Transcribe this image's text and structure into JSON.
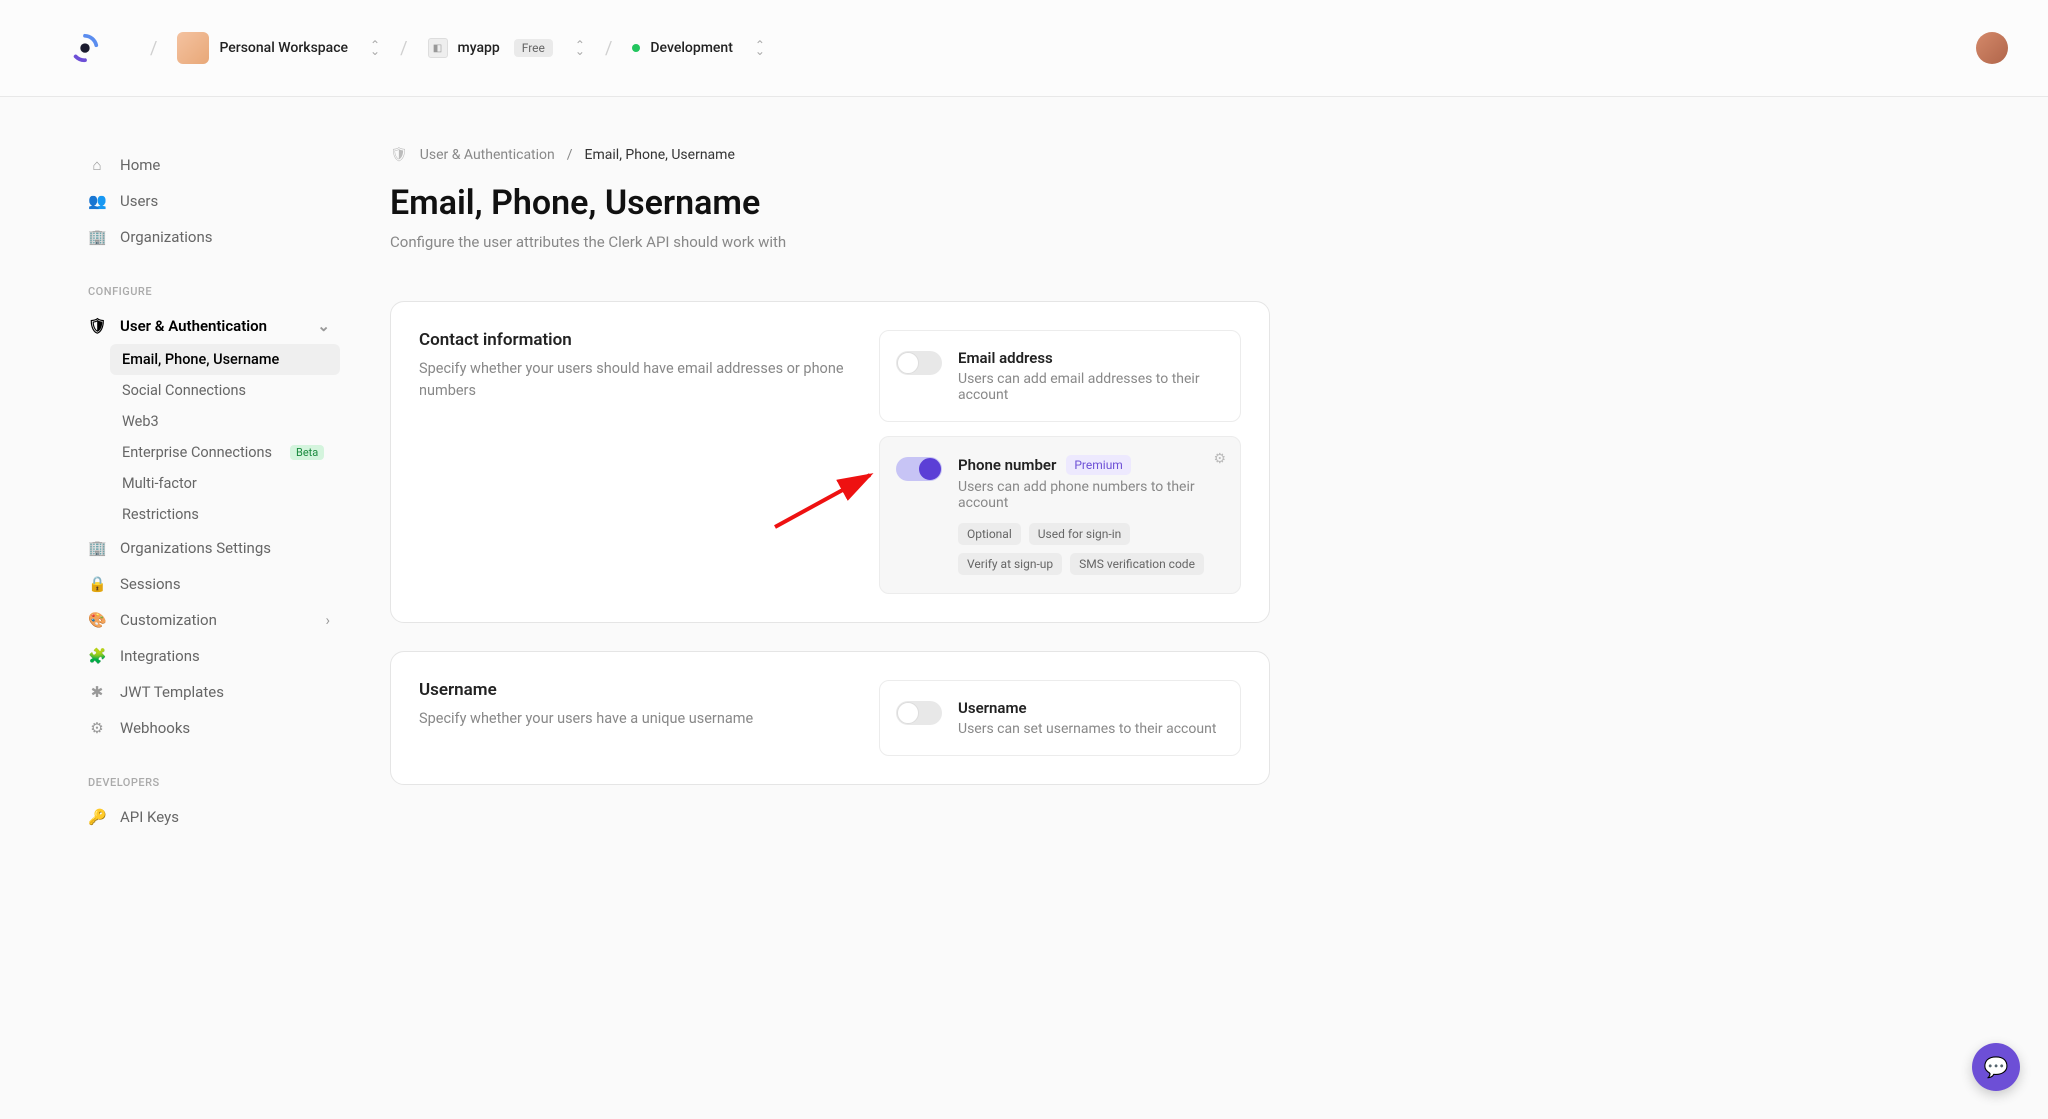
{
  "topbar": {
    "workspace": "Personal Workspace",
    "app": "myapp",
    "app_badge": "Free",
    "environment": "Development"
  },
  "sidebar": {
    "top": [
      {
        "icon": "home",
        "label": "Home"
      },
      {
        "icon": "users",
        "label": "Users"
      },
      {
        "icon": "building",
        "label": "Organizations"
      }
    ],
    "configure_heading": "CONFIGURE",
    "user_auth_label": "User & Authentication",
    "user_auth_sub": [
      {
        "label": "Email, Phone, Username",
        "active": true
      },
      {
        "label": "Social Connections"
      },
      {
        "label": "Web3"
      },
      {
        "label": "Enterprise Connections",
        "badge": "Beta"
      },
      {
        "label": "Multi-factor"
      },
      {
        "label": "Restrictions"
      }
    ],
    "rest": [
      {
        "icon": "building",
        "label": "Organizations Settings"
      },
      {
        "icon": "lock",
        "label": "Sessions"
      },
      {
        "icon": "palette",
        "label": "Customization",
        "chevron": true
      },
      {
        "icon": "puzzle",
        "label": "Integrations"
      },
      {
        "icon": "snow",
        "label": "JWT Templates"
      },
      {
        "icon": "webhook",
        "label": "Webhooks"
      }
    ],
    "developers_heading": "DEVELOPERS",
    "developers": [
      {
        "icon": "key",
        "label": "API Keys"
      }
    ]
  },
  "breadcrumb": {
    "parent": "User & Authentication",
    "current": "Email, Phone, Username"
  },
  "page": {
    "title": "Email, Phone, Username",
    "subtitle": "Configure the user attributes the Clerk API should work with"
  },
  "panels": {
    "contact": {
      "title": "Contact information",
      "desc": "Specify whether your users should have email addresses or phone numbers",
      "options": [
        {
          "title": "Email address",
          "desc": "Users can add email addresses to their account",
          "on": false
        },
        {
          "title": "Phone number",
          "premium": "Premium",
          "desc": "Users can add phone numbers to their account",
          "on": true,
          "highlighted": true,
          "gear": true,
          "tags": [
            "Optional",
            "Used for sign-in",
            "Verify at sign-up",
            "SMS verification code"
          ]
        }
      ]
    },
    "username": {
      "title": "Username",
      "desc": "Specify whether your users have a unique username",
      "options": [
        {
          "title": "Username",
          "desc": "Users can set usernames to their account",
          "on": false
        }
      ]
    }
  }
}
